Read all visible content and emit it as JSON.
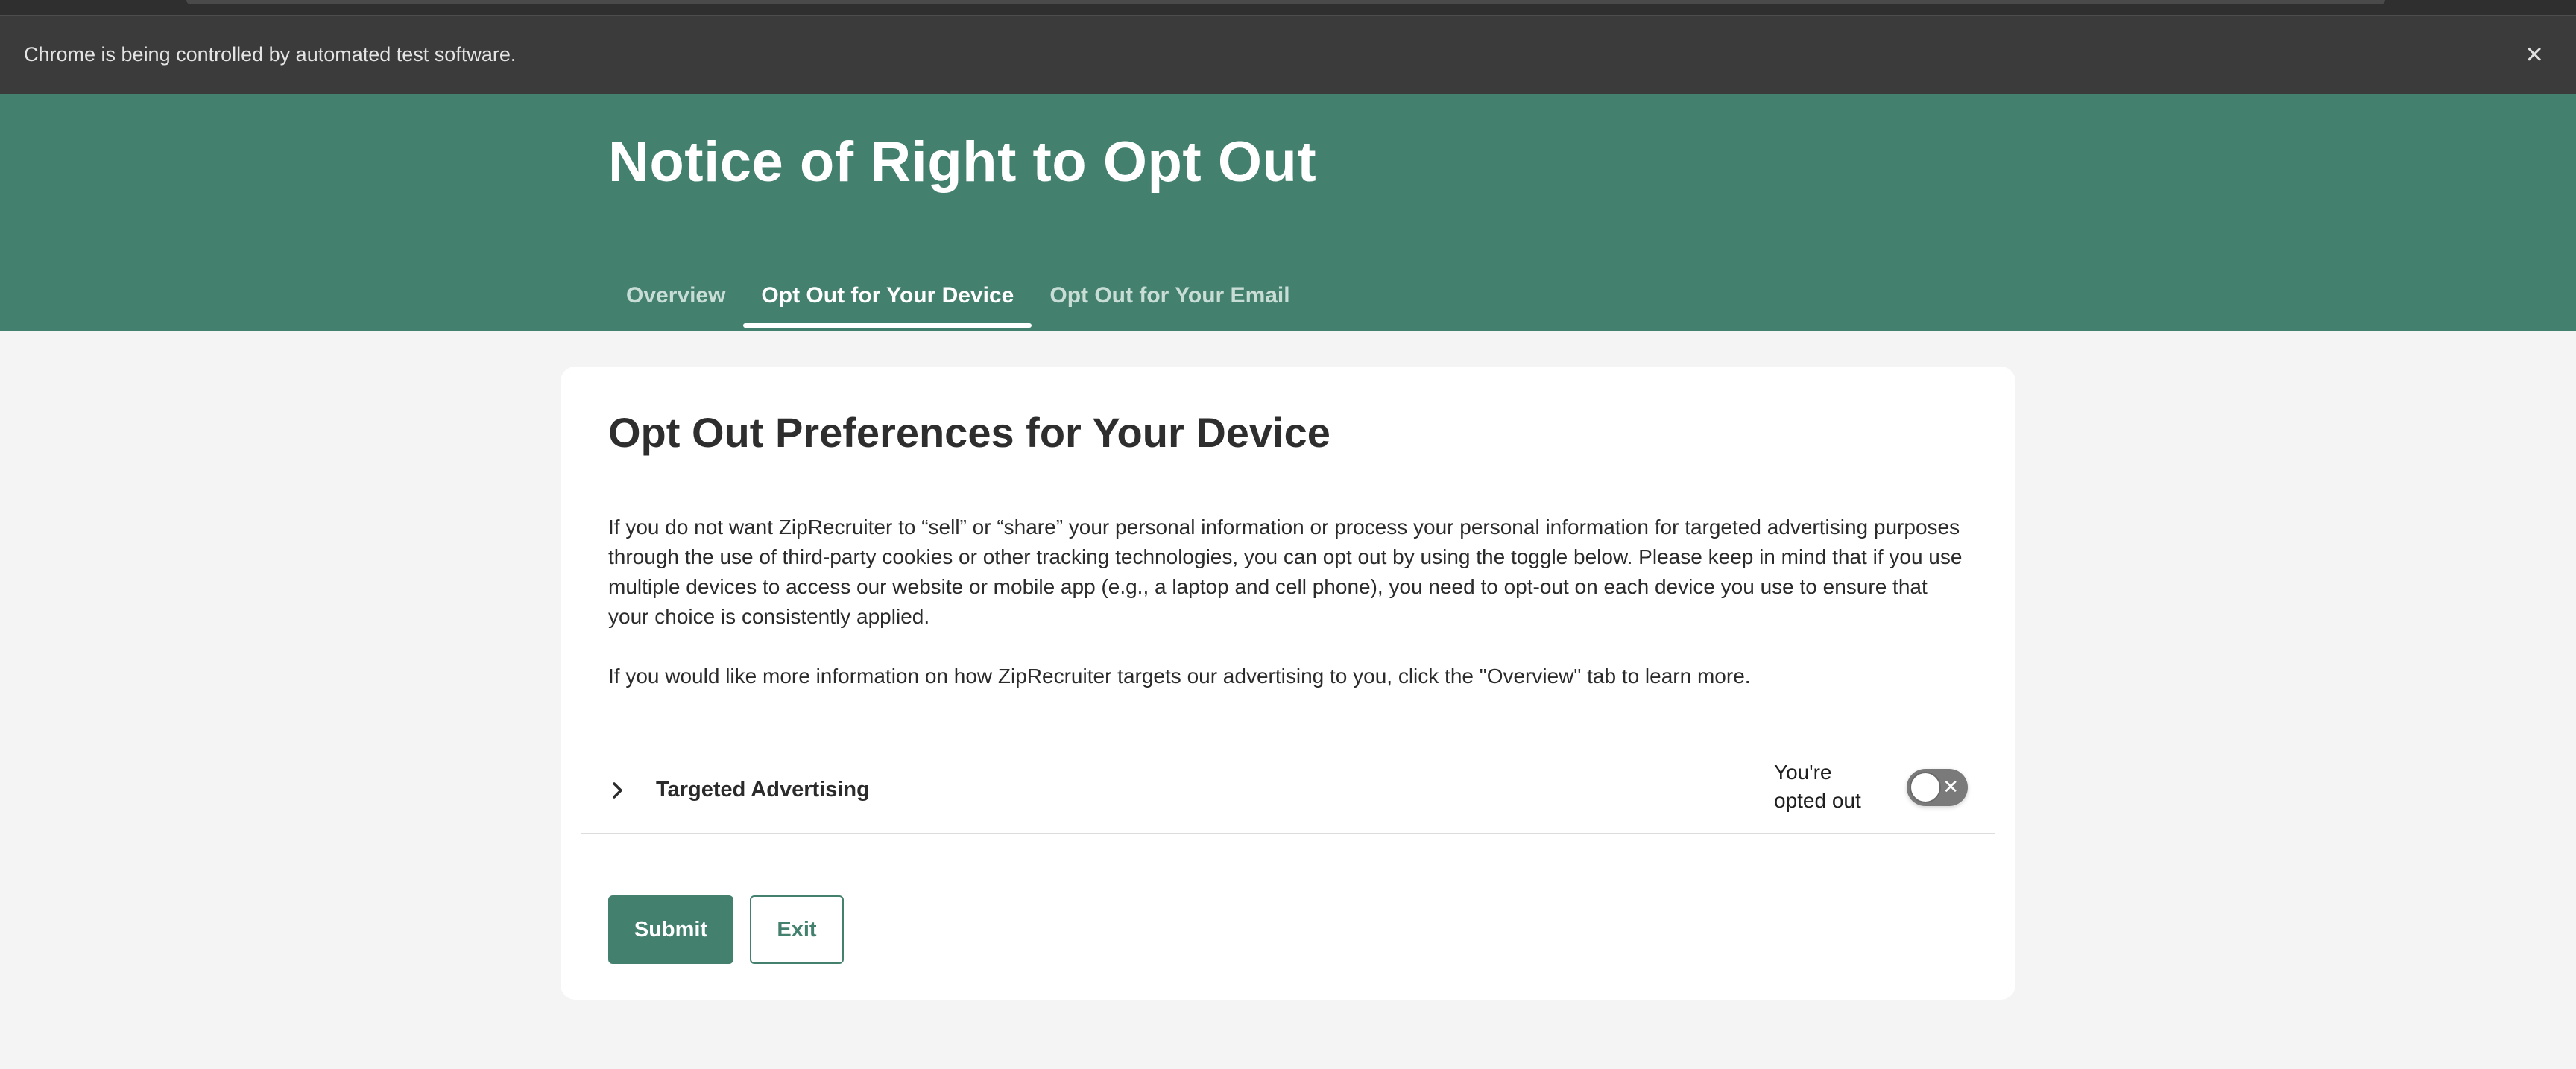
{
  "browser": {
    "automation_notice": "Chrome is being controlled by automated test software."
  },
  "header": {
    "title": "Notice of Right to Opt Out",
    "tabs": [
      {
        "label": "Overview",
        "active": false
      },
      {
        "label": "Opt Out for Your Device",
        "active": true
      },
      {
        "label": "Opt Out for Your Email",
        "active": false
      }
    ]
  },
  "card": {
    "title": "Opt Out Preferences for Your Device",
    "paragraph1": "If you do not want ZipRecruiter to “sell” or “share” your personal information or process your personal information for targeted advertising purposes through the use of third-party cookies or other tracking technologies, you can opt out by using the toggle below. Please keep in mind that if you use multiple devices to access our website or mobile app (e.g., a laptop and cell phone), you need to opt-out on each device you use to ensure that your choice is consistently applied.",
    "paragraph2": "If you would like more information on how ZipRecruiter targets our advertising to you, click the \"Overview\" tab to learn more.",
    "accordion": {
      "label": "Targeted Advertising",
      "status": "You're opted out",
      "toggle_on": false,
      "toggle_icon": "close-icon"
    },
    "buttons": {
      "submit": "Submit",
      "exit": "Exit"
    }
  },
  "colors": {
    "brand_green": "#44806e",
    "automation_bar": "#3b3b3b",
    "page_bg": "#f4f4f4"
  }
}
